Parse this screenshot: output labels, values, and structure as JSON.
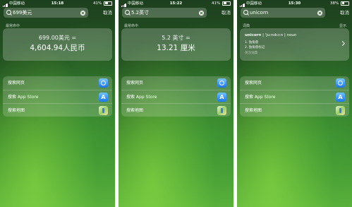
{
  "status": {
    "carrier": "中国移动",
    "battery": [
      "41%",
      "41%",
      "38%"
    ],
    "times": [
      "15:18",
      "15:22",
      "15:30"
    ]
  },
  "screens": [
    {
      "query": "699美元",
      "cancel": "取消",
      "section": "最常命中",
      "result_line1": "699.00美元 =",
      "result_line2": "4,604.94人民币",
      "actions": [
        "搜索网页",
        "搜索 App Store",
        "搜索地图"
      ]
    },
    {
      "query": "5.2英寸",
      "cancel": "取消",
      "section": "最常命中",
      "result_line1": "5.2 英寸 =",
      "result_line2": "13.21 厘米",
      "actions": [
        "搜索网页",
        "搜索 App Store",
        "搜索地图"
      ]
    },
    {
      "query": "unicorn",
      "cancel": "取消",
      "section": "词典",
      "section_more": "显示",
      "dict_word": "unicorn",
      "dict_phonetic": "ˈjuːnɪkɔːn",
      "dict_pos": "noun",
      "dict_def1": "1. 独角兽",
      "dict_def2": "2. 独角兽标记",
      "dict_source": "英汉词典",
      "actions": [
        "搜索网页",
        "搜索 App Store",
        "搜索地图"
      ]
    }
  ],
  "icons": [
    "safari-icon",
    "app-store-icon",
    "maps-icon"
  ]
}
